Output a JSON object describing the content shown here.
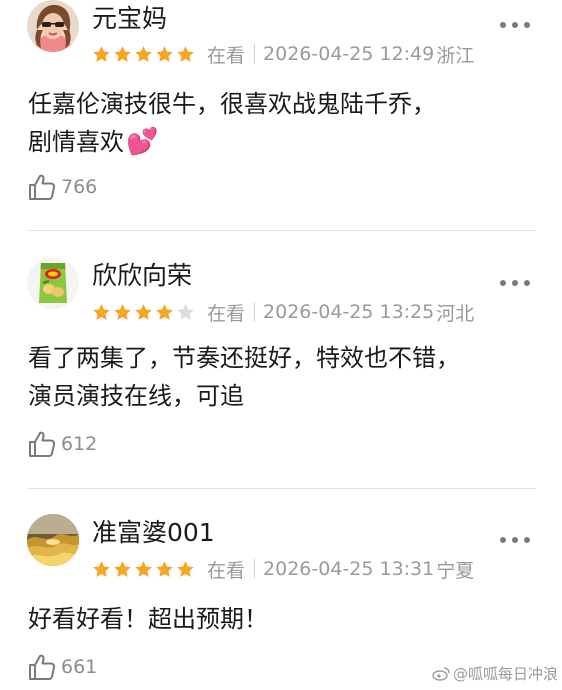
{
  "comments": [
    {
      "username": "元宝妈",
      "rating": 5,
      "status": "在看",
      "time": "2026-04-25 12:49",
      "location": "浙江",
      "line1": "任嘉伦演技很牛，很喜欢战鬼陆千乔，",
      "line2": "剧情喜欢",
      "emoji": "💕",
      "likes": "766",
      "avatar_icon": "woman-with-sunglasses-avatar"
    },
    {
      "username": "欣欣向荣",
      "rating": 4,
      "status": "在看",
      "time": "2026-04-25 13:25",
      "location": "河北",
      "line1": "看了两集了，节奏还挺好，特效也不错，",
      "line2": "演员演技在线，可追",
      "likes": "612",
      "avatar_icon": "chips-bag-avatar"
    },
    {
      "username": "准富婆001",
      "rating": 5,
      "status": "在看",
      "time": "2026-04-25 13:31",
      "location": "宁夏",
      "line1": "好看好看！超出预期！",
      "likes": "661",
      "avatar_icon": "golden-wave-avatar"
    }
  ],
  "watermark": "@呱呱每日冲浪",
  "colors": {
    "star_on": "#f5a623",
    "star_off": "#dcdcdc",
    "meta_text": "#9a9a9a",
    "icon_gray": "#7a7a7a"
  }
}
